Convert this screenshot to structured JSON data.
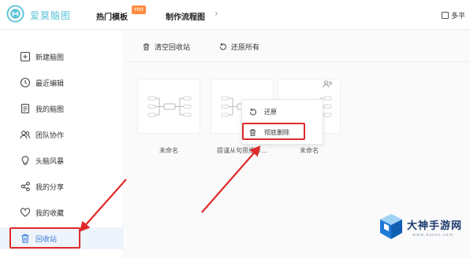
{
  "header": {
    "app_name": "爱莫脑图",
    "tabs": [
      {
        "label": "热门模板",
        "badge": "Hot"
      },
      {
        "label": "制作流程图"
      }
    ],
    "right_label": "多平"
  },
  "sidebar": {
    "items": [
      {
        "label": "新建脑图",
        "icon": "add-doc-icon"
      },
      {
        "label": "最近编辑",
        "icon": "clock-icon"
      },
      {
        "label": "我的脑图",
        "icon": "document-icon"
      },
      {
        "label": "团队协作",
        "icon": "team-icon"
      },
      {
        "label": "头脑风暴",
        "icon": "lightbulb-icon"
      },
      {
        "label": "我的分享",
        "icon": "share-icon"
      },
      {
        "label": "我的收藏",
        "icon": "heart-icon"
      },
      {
        "label": "回收站",
        "icon": "trash-icon",
        "active": true
      }
    ]
  },
  "toolbar": {
    "empty_label": "清空回收站",
    "restore_all_label": "还原所有"
  },
  "files": [
    {
      "name": "未命名"
    },
    {
      "name": "提谨从句思维导..."
    },
    {
      "name": "未命名"
    }
  ],
  "context_menu": {
    "items": [
      {
        "label": "还原",
        "icon": "restore-icon"
      },
      {
        "label": "彻底删除",
        "icon": "trash-icon"
      }
    ]
  },
  "watermark": {
    "title": "大神手游网",
    "url": "www.dsssv.com"
  },
  "colors": {
    "accent": "#3d7bd6",
    "logo": "#5cc3d8",
    "annotation": "#e02a2a",
    "badge": "#ff8a3d"
  }
}
